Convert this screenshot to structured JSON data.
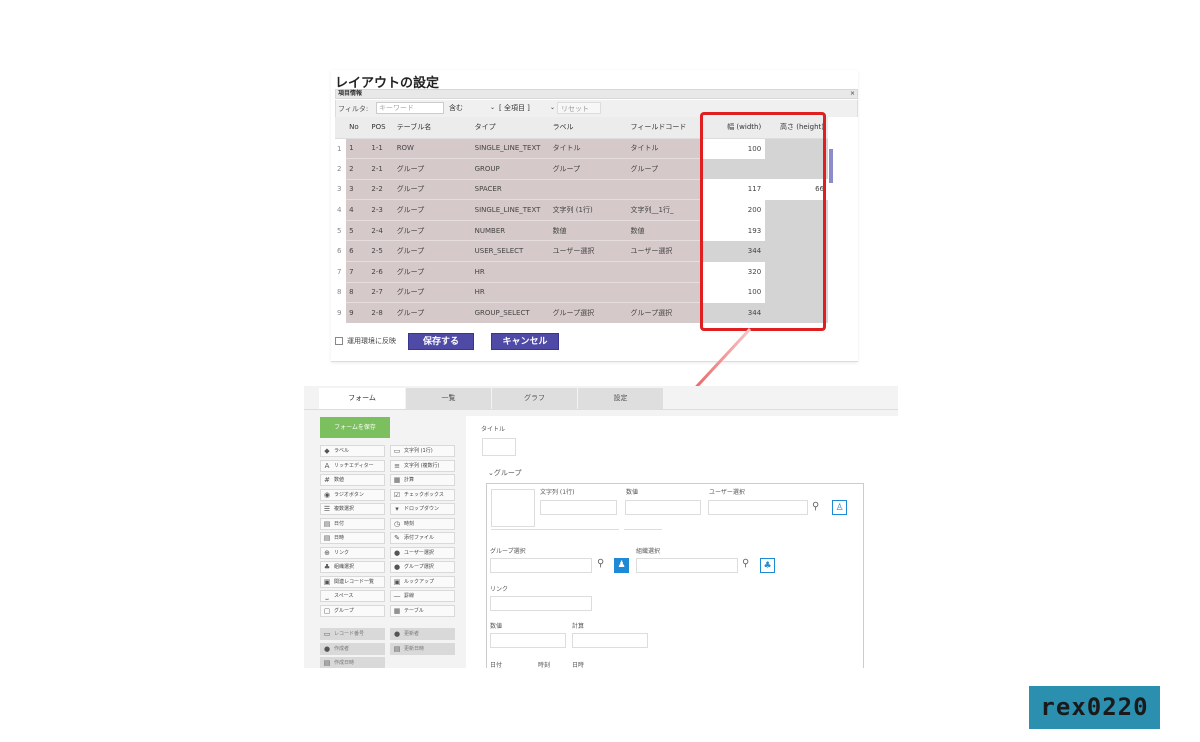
{
  "dialog": {
    "title": "レイアウトの設定",
    "panel_title": "項目情報",
    "close_symbol": "×",
    "filter": {
      "label": "フィルタ:",
      "keyword_placeholder": "キーワード",
      "match_select": "含む",
      "field_select": "[ 全項目 ]",
      "reset_label": "リセット"
    },
    "columns": [
      "No",
      "POS",
      "テーブル名",
      "タイプ",
      "ラベル",
      "フィールドコード",
      "幅 (width)",
      "高さ (height)"
    ],
    "rows": [
      {
        "rn": "1",
        "no": "1",
        "pos": "1-1",
        "table": "ROW",
        "type": "SINGLE_LINE_TEXT",
        "label": "タイトル",
        "code": "タイトル",
        "width": "100",
        "height": ""
      },
      {
        "rn": "2",
        "no": "2",
        "pos": "2-1",
        "table": "グループ",
        "type": "GROUP",
        "label": "グループ",
        "code": "グループ",
        "width": "",
        "height": ""
      },
      {
        "rn": "3",
        "no": "3",
        "pos": "2-2",
        "table": "グループ",
        "type": "SPACER",
        "label": "",
        "code": "",
        "width": "117",
        "height": "66"
      },
      {
        "rn": "4",
        "no": "4",
        "pos": "2-3",
        "table": "グループ",
        "type": "SINGLE_LINE_TEXT",
        "label": "文字列 (1行)",
        "code": "文字列__1行_",
        "width": "200",
        "height": ""
      },
      {
        "rn": "5",
        "no": "5",
        "pos": "2-4",
        "table": "グループ",
        "type": "NUMBER",
        "label": "数値",
        "code": "数値",
        "width": "193",
        "height": ""
      },
      {
        "rn": "6",
        "no": "6",
        "pos": "2-5",
        "table": "グループ",
        "type": "USER_SELECT",
        "label": "ユーザー選択",
        "code": "ユーザー選択",
        "width": "344",
        "height": ""
      },
      {
        "rn": "7",
        "no": "7",
        "pos": "2-6",
        "table": "グループ",
        "type": "HR",
        "label": "",
        "code": "",
        "width": "320",
        "height": ""
      },
      {
        "rn": "8",
        "no": "8",
        "pos": "2-7",
        "table": "グループ",
        "type": "HR",
        "label": "",
        "code": "",
        "width": "100",
        "height": ""
      },
      {
        "rn": "9",
        "no": "9",
        "pos": "2-8",
        "table": "グループ",
        "type": "GROUP_SELECT",
        "label": "グループ選択",
        "code": "グループ選択",
        "width": "344",
        "height": ""
      }
    ],
    "apply_label": "運用環境に反映",
    "save_label": "保存する",
    "cancel_label": "キャンセル"
  },
  "form": {
    "tabs": [
      "フォーム",
      "一覧",
      "グラフ",
      "設定"
    ],
    "save_form_label": "フォームを保存",
    "palette": [
      {
        "label": "ラベル",
        "icon": "tag-icon",
        "glyph": "◆"
      },
      {
        "label": "文字列 (1行)",
        "icon": "text-line-icon",
        "glyph": "▭"
      },
      {
        "label": "リッチエディター",
        "icon": "rich-editor-icon",
        "glyph": "A"
      },
      {
        "label": "文字列 (複数行)",
        "icon": "text-multiline-icon",
        "glyph": "≡"
      },
      {
        "label": "数値",
        "icon": "number-icon",
        "glyph": "#"
      },
      {
        "label": "計算",
        "icon": "calc-icon",
        "glyph": "▦"
      },
      {
        "label": "ラジオボタン",
        "icon": "radio-icon",
        "glyph": "◉"
      },
      {
        "label": "チェックボックス",
        "icon": "checkbox-icon",
        "glyph": "☑"
      },
      {
        "label": "複数選択",
        "icon": "multi-select-icon",
        "glyph": "☰"
      },
      {
        "label": "ドロップダウン",
        "icon": "dropdown-icon",
        "glyph": "▾"
      },
      {
        "label": "日付",
        "icon": "date-icon",
        "glyph": "▤"
      },
      {
        "label": "時刻",
        "icon": "clock-icon",
        "glyph": "◷"
      },
      {
        "label": "日時",
        "icon": "datetime-icon",
        "glyph": "▤"
      },
      {
        "label": "添付ファイル",
        "icon": "paperclip-icon",
        "glyph": "✎"
      },
      {
        "label": "リンク",
        "icon": "link-icon",
        "glyph": "⊕"
      },
      {
        "label": "ユーザー選択",
        "icon": "user-icon",
        "glyph": "●"
      },
      {
        "label": "組織選択",
        "icon": "org-icon",
        "glyph": "♣"
      },
      {
        "label": "グループ選択",
        "icon": "group-icon",
        "glyph": "●"
      },
      {
        "label": "関連レコード一覧",
        "icon": "related-records-icon",
        "glyph": "▣"
      },
      {
        "label": "ルックアップ",
        "icon": "lookup-icon",
        "glyph": "▣"
      },
      {
        "label": "スペース",
        "icon": "space-icon",
        "glyph": "⎵"
      },
      {
        "label": "罫線",
        "icon": "hr-icon",
        "glyph": "—"
      },
      {
        "label": "グループ",
        "icon": "group-box-icon",
        "glyph": "▢"
      },
      {
        "label": "テーブル",
        "icon": "table-icon",
        "glyph": "▦"
      }
    ],
    "system_fields": [
      {
        "label": "レコード番号",
        "icon": "record-number-icon",
        "glyph": "▭"
      },
      {
        "label": "作成者",
        "icon": "creator-icon",
        "glyph": "●"
      },
      {
        "label": "作成日時",
        "icon": "created-at-icon",
        "glyph": "▤"
      },
      {
        "label": "更新者",
        "icon": "modifier-icon",
        "glyph": "●"
      },
      {
        "label": "更新日時",
        "icon": "updated-at-icon",
        "glyph": "▤"
      }
    ],
    "canvas": {
      "title_label": "タイトル",
      "group_label": "グループ",
      "text_label": "文字列 (1行)",
      "number_label": "数値",
      "user_select_label": "ユーザー選択",
      "group_select_label": "グループ選択",
      "org_select_label": "組織選択",
      "link_label": "リンク",
      "number2_label": "数値",
      "calc_label": "計算",
      "date_label": "日付",
      "time_label": "時刻",
      "datetime_label": "日時"
    }
  },
  "watermark": "rex0220",
  "colors": {
    "highlight": "#e02020",
    "primary_button": "#4e4aa6",
    "save_form": "#7bbf5e",
    "selector_blue": "#1e8ad6",
    "watermark_bg": "#2b8fb0"
  }
}
